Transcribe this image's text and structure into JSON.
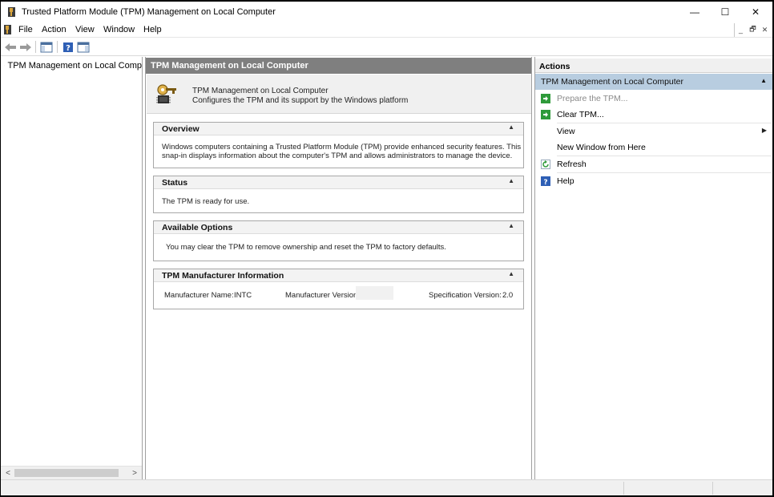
{
  "window": {
    "title": "Trusted Platform Module (TPM) Management on Local Computer",
    "controls": {
      "minimize": "—",
      "maximize": "☐",
      "close": "✕"
    }
  },
  "menu": {
    "items": [
      "File",
      "Action",
      "View",
      "Window",
      "Help"
    ],
    "mdi_controls": [
      "_",
      "🗗",
      "✕"
    ]
  },
  "toolbar": {
    "buttons": [
      "back-icon",
      "forward-icon",
      "show-hide-console-tree-icon",
      "help-icon",
      "show-hide-action-pane-icon"
    ]
  },
  "tree": {
    "items": [
      {
        "label": "TPM Management on Local Comp",
        "icon": "tpm-key-icon"
      }
    ],
    "scroll": {
      "left": "<",
      "right": ">"
    }
  },
  "center": {
    "header": "TPM Management on Local Computer",
    "banner": {
      "title": "TPM Management on Local Computer",
      "subtitle": "Configures the TPM and its support by the Windows platform"
    },
    "sections": {
      "overview": {
        "title": "Overview",
        "line1": "Windows computers containing a Trusted Platform Module (TPM) provide enhanced security features. This",
        "line2": "snap-in displays information about the computer's TPM and allows administrators to manage the device."
      },
      "status": {
        "title": "Status",
        "text": "The TPM is ready for use."
      },
      "options": {
        "title": "Available Options",
        "text": "You may clear the TPM to remove ownership and reset the TPM to factory defaults."
      },
      "manufacturer": {
        "title": "TPM Manufacturer Information",
        "name_label": "Manufacturer Name:",
        "name_value": "INTC",
        "version_label": "Manufacturer Version:",
        "version_value": "",
        "spec_label": "Specification Version:",
        "spec_value": "2.0"
      }
    }
  },
  "actions": {
    "header": "Actions",
    "group": "TPM Management on Local Computer",
    "items": [
      {
        "label": "Prepare the TPM...",
        "icon": "green-arrow-icon",
        "enabled": false
      },
      {
        "label": "Clear TPM...",
        "icon": "green-arrow-icon",
        "enabled": true
      },
      {
        "label": "View",
        "icon": "",
        "enabled": true,
        "submenu": true
      },
      {
        "label": "New Window from Here",
        "icon": "",
        "enabled": true
      },
      {
        "label": "Refresh",
        "icon": "refresh-icon",
        "enabled": true
      },
      {
        "label": "Help",
        "icon": "help-icon",
        "enabled": true
      }
    ]
  },
  "colors": {
    "center_header": "#7f7f7f",
    "action_group": "#b8cde0",
    "action_icon_green": "#2e9a3a",
    "help_icon_blue": "#2e5fb5"
  }
}
